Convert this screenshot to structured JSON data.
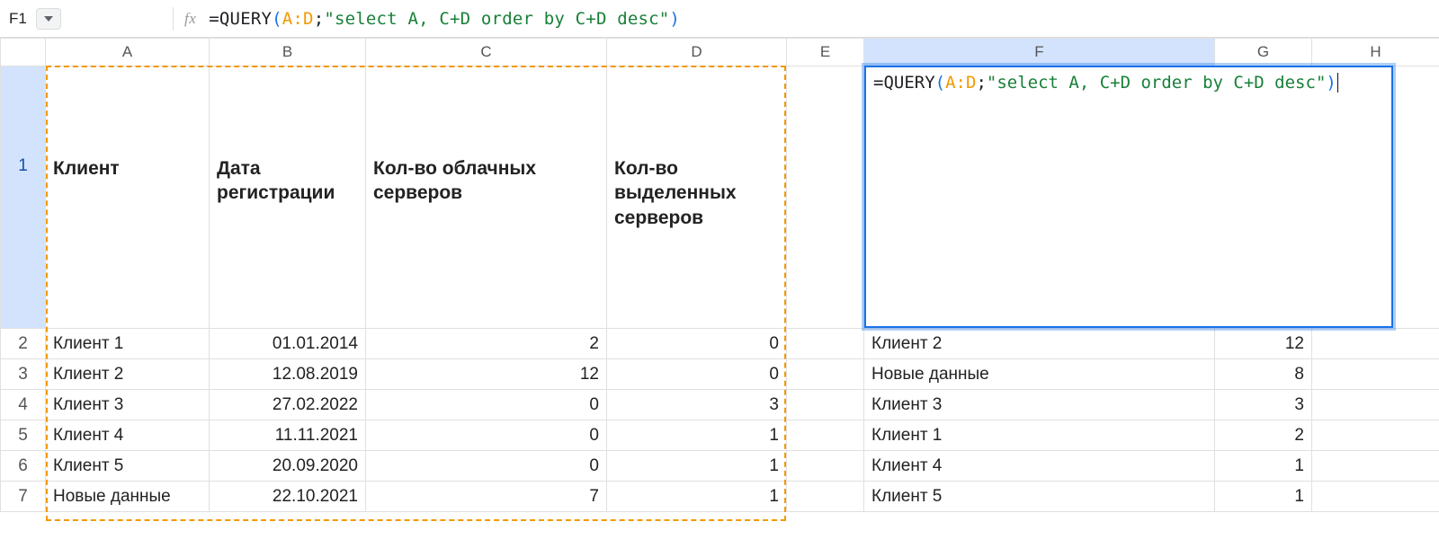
{
  "cellRef": "F1",
  "formula": {
    "eq": "=",
    "fn": "QUERY",
    "open": "(",
    "ref": "A:D",
    "sep": ";",
    "str": "\"select A, C+D order by C+D desc\"",
    "close": ")"
  },
  "columns": [
    "A",
    "B",
    "C",
    "D",
    "E",
    "F",
    "G",
    "H"
  ],
  "header": {
    "A": "Клиент",
    "B": "Дата регистрации",
    "C": "Кол-во облачных серверов",
    "D": "Кол-во выделенных серверов"
  },
  "rows": [
    {
      "n": "2",
      "A": "Клиент 1",
      "B": "01.01.2014",
      "C": "2",
      "D": "0",
      "F": "Клиент 2",
      "G": "12"
    },
    {
      "n": "3",
      "A": "Клиент 2",
      "B": "12.08.2019",
      "C": "12",
      "D": "0",
      "F": "Новые данные",
      "G": "8"
    },
    {
      "n": "4",
      "A": "Клиент 3",
      "B": "27.02.2022",
      "C": "0",
      "D": "3",
      "F": "Клиент 3",
      "G": "3"
    },
    {
      "n": "5",
      "A": "Клиент 4",
      "B": "11.11.2021",
      "C": "0",
      "D": "1",
      "F": "Клиент 1",
      "G": "2"
    },
    {
      "n": "6",
      "A": "Клиент 5",
      "B": "20.09.2020",
      "C": "0",
      "D": "1",
      "F": "Клиент 4",
      "G": "1"
    },
    {
      "n": "7",
      "A": "Новые данные",
      "B": "22.10.2021",
      "C": "7",
      "D": "1",
      "F": "Клиент 5",
      "G": "1"
    }
  ]
}
